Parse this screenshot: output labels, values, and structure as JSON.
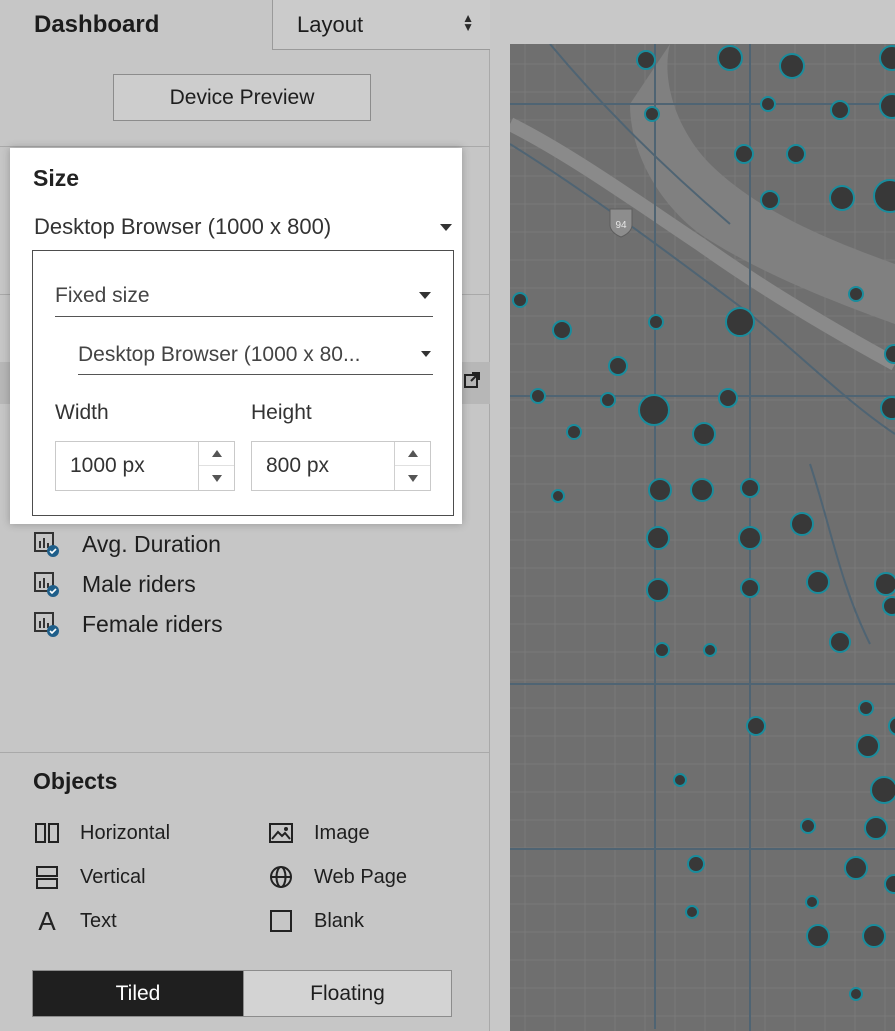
{
  "tabs": {
    "dashboard": "Dashboard",
    "layout": "Layout"
  },
  "device_preview_label": "Device Preview",
  "size": {
    "title": "Size",
    "selected": "Desktop Browser (1000 x 800)",
    "sizing_mode": "Fixed size",
    "preset": "Desktop Browser (1000 x 80...",
    "width_label": "Width",
    "height_label": "Height",
    "width_value": "1000 px",
    "height_value": "800 px"
  },
  "sheets": [
    {
      "label": "Avg. Duration"
    },
    {
      "label": "Male riders"
    },
    {
      "label": "Female riders"
    }
  ],
  "objects": {
    "title": "Objects",
    "items": [
      {
        "label": "Horizontal",
        "icon": "horizontal-icon"
      },
      {
        "label": "Image",
        "icon": "image-icon"
      },
      {
        "label": "Vertical",
        "icon": "vertical-icon"
      },
      {
        "label": "Web Page",
        "icon": "globe-icon"
      },
      {
        "label": "Text",
        "icon": "text-icon"
      },
      {
        "label": "Blank",
        "icon": "blank-icon"
      }
    ]
  },
  "layout_toggle": {
    "tiled": "Tiled",
    "floating": "Floating"
  },
  "map": {
    "highway_shield": "94",
    "colors": {
      "land": "#6f6f6f",
      "water": "#8a8a8a",
      "road": "#4f6473",
      "dot": "#383838",
      "dot_ring": "#1a8c9c"
    }
  }
}
